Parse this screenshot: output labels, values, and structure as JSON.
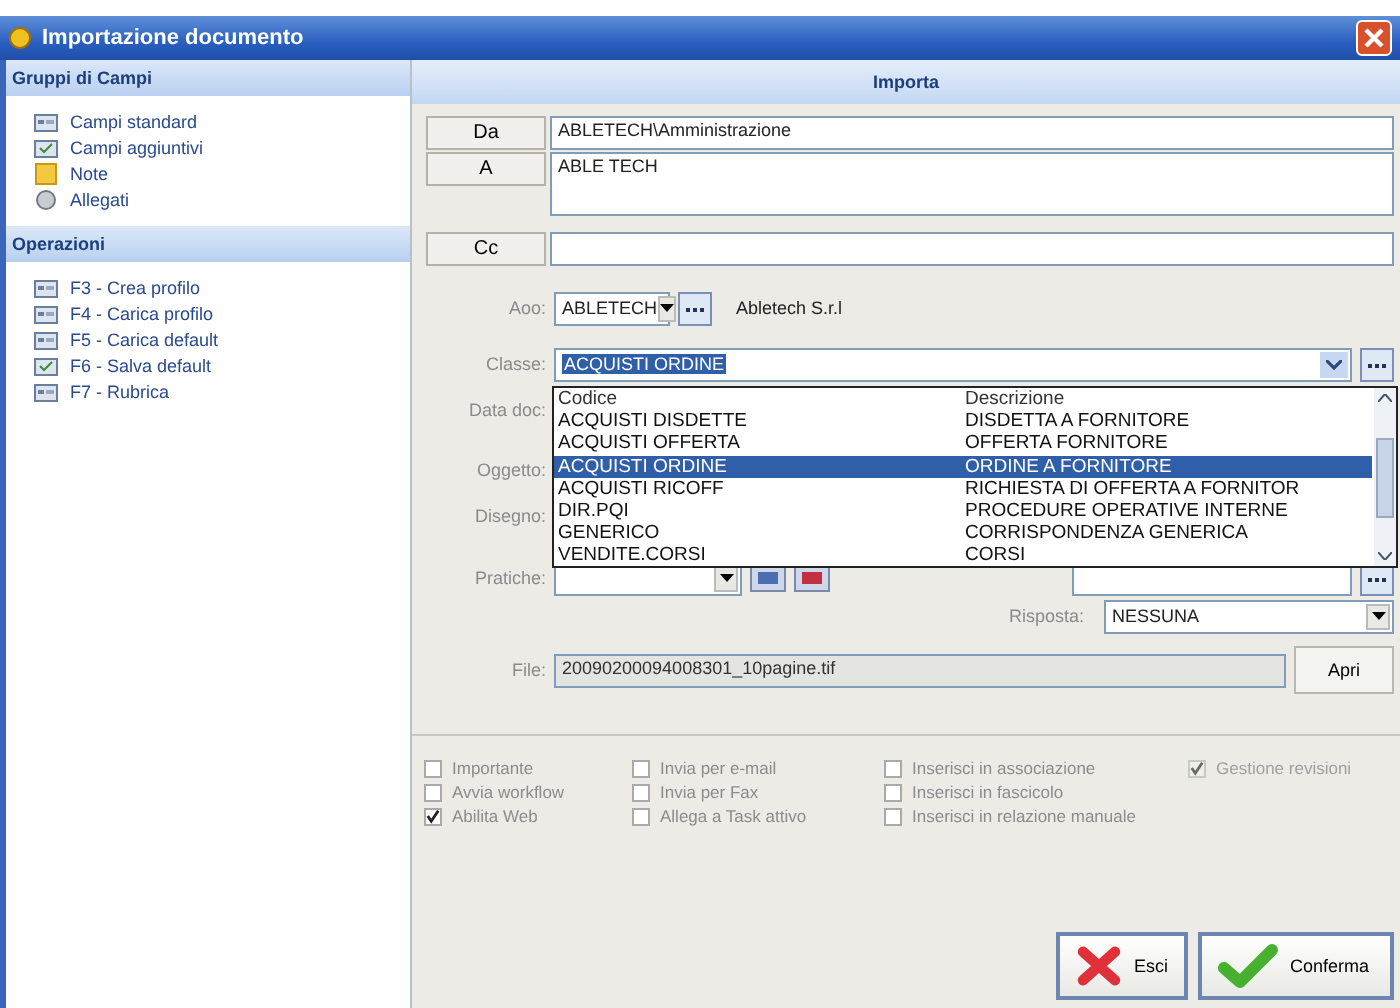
{
  "window": {
    "title": "Importazione documento"
  },
  "sidebar": {
    "groups": [
      {
        "title": "Gruppi di Campi",
        "items": [
          {
            "label": "Campi standard"
          },
          {
            "label": "Campi aggiuntivi"
          },
          {
            "label": "Note"
          },
          {
            "label": "Allegati"
          }
        ]
      },
      {
        "title": "Operazioni",
        "items": [
          {
            "label": "F3 - Crea profilo"
          },
          {
            "label": "F4 - Carica profilo"
          },
          {
            "label": "F5 - Carica default"
          },
          {
            "label": "F6 - Salva default"
          },
          {
            "label": "F7 - Rubrica"
          }
        ]
      }
    ]
  },
  "form": {
    "header": "Importa",
    "recipients": [
      {
        "label": "Da",
        "value": "ABLETECH\\Amministrazione",
        "tall": false
      },
      {
        "label": "A",
        "value": "ABLE TECH",
        "tall": true
      },
      {
        "label": "Cc",
        "tall": false
      }
    ],
    "aoo": {
      "label": "Aoo:",
      "value": "ABLETECH",
      "name": "Abletech S.r.l"
    },
    "classe": {
      "label": "Classe:",
      "value": "ACQUISTI ORDINE"
    },
    "classe_list": {
      "columns": [
        "Codice",
        "Descrizione"
      ],
      "rows": [
        {
          "cells": [
            "ACQUISTI DISDETTE",
            "DISDETTA A FORNITORE"
          ],
          "selected": false
        },
        {
          "cells": [
            "ACQUISTI OFFERTA",
            "OFFERTA FORNITORE"
          ],
          "selected": false
        },
        {
          "cells": [
            "ACQUISTI ORDINE",
            "ORDINE A FORNITORE"
          ],
          "selected": true
        },
        {
          "cells": [
            "ACQUISTI RICOFF",
            "RICHIESTA DI OFFERTA A FORNITOR"
          ],
          "selected": false
        },
        {
          "cells": [
            "DIR.PQI",
            "PROCEDURE OPERATIVE INTERNE"
          ],
          "selected": false
        },
        {
          "cells": [
            "GENERICO",
            "CORRISPONDENZA GENERICA"
          ],
          "selected": false
        },
        {
          "cells": [
            "VENDITE.CORSI",
            "CORSI"
          ],
          "selected": false
        }
      ]
    },
    "hidden_labels": [
      "Data doc:",
      "Oggetto:",
      "Disegno:"
    ],
    "pratiche": {
      "label": "Pratiche:"
    },
    "risposta": {
      "label": "Risposta:",
      "value": "NESSUNA"
    },
    "file": {
      "label": "File:",
      "value": "20090200094008301_10pagine.tif",
      "button": "Apri"
    }
  },
  "options": [
    {
      "label": "Importante",
      "checked": false,
      "disabled": false
    },
    {
      "label": "Avvia workflow",
      "checked": false,
      "disabled": false
    },
    {
      "label": "Abilita Web",
      "checked": true,
      "disabled": false
    },
    {
      "label": "Invia per e-mail",
      "checked": false,
      "disabled": false
    },
    {
      "label": "Invia per Fax",
      "checked": false,
      "disabled": false
    },
    {
      "label": "Allega a Task attivo",
      "checked": false,
      "disabled": false
    },
    {
      "label": "Inserisci in associazione",
      "checked": false,
      "disabled": false
    },
    {
      "label": "Inserisci in fascicolo",
      "checked": false,
      "disabled": false
    },
    {
      "label": "Inserisci in relazione manuale",
      "checked": false,
      "disabled": false
    },
    {
      "label": "Gestione revisioni",
      "checked": true,
      "disabled": true
    }
  ],
  "buttons": [
    {
      "label": "Esci",
      "kind": "cancel"
    },
    {
      "label": "Conferma",
      "kind": "ok"
    }
  ]
}
